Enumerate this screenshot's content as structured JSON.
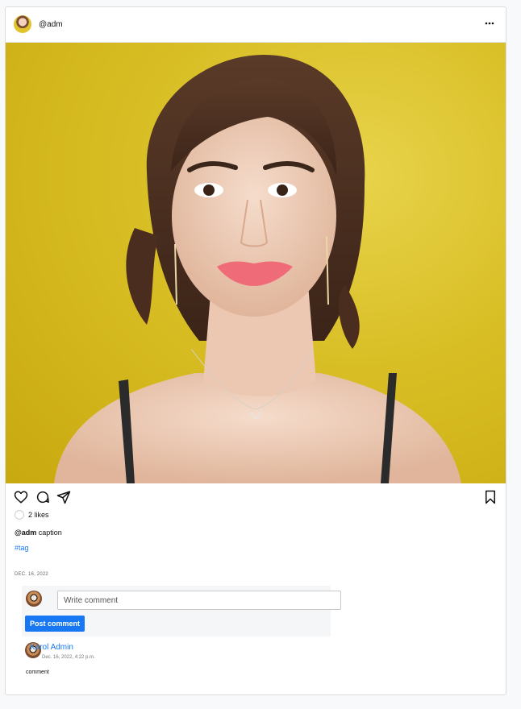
{
  "post": {
    "author": "@adm",
    "more_icon": "more-horizontal-icon",
    "photo_alt": "portrait of a woman on yellow background",
    "likes_text": "2 likes",
    "caption_author": "@adm",
    "caption_text": " caption",
    "hashtag": "#tag",
    "date": "DEC. 16, 2022"
  },
  "actions": {
    "like_icon": "heart-icon",
    "comment_icon": "comment-icon",
    "share_icon": "send-icon",
    "save_icon": "bookmark-icon"
  },
  "comment_form": {
    "placeholder": "Write comment",
    "submit_label": "Post comment"
  },
  "comments": [
    {
      "author": "Karol Admin",
      "date": "Dec. 16, 2022, 4:22 p.m.",
      "text": "comment"
    }
  ],
  "colors": {
    "accent": "#1877f2",
    "photo_background": "#d8be24"
  }
}
